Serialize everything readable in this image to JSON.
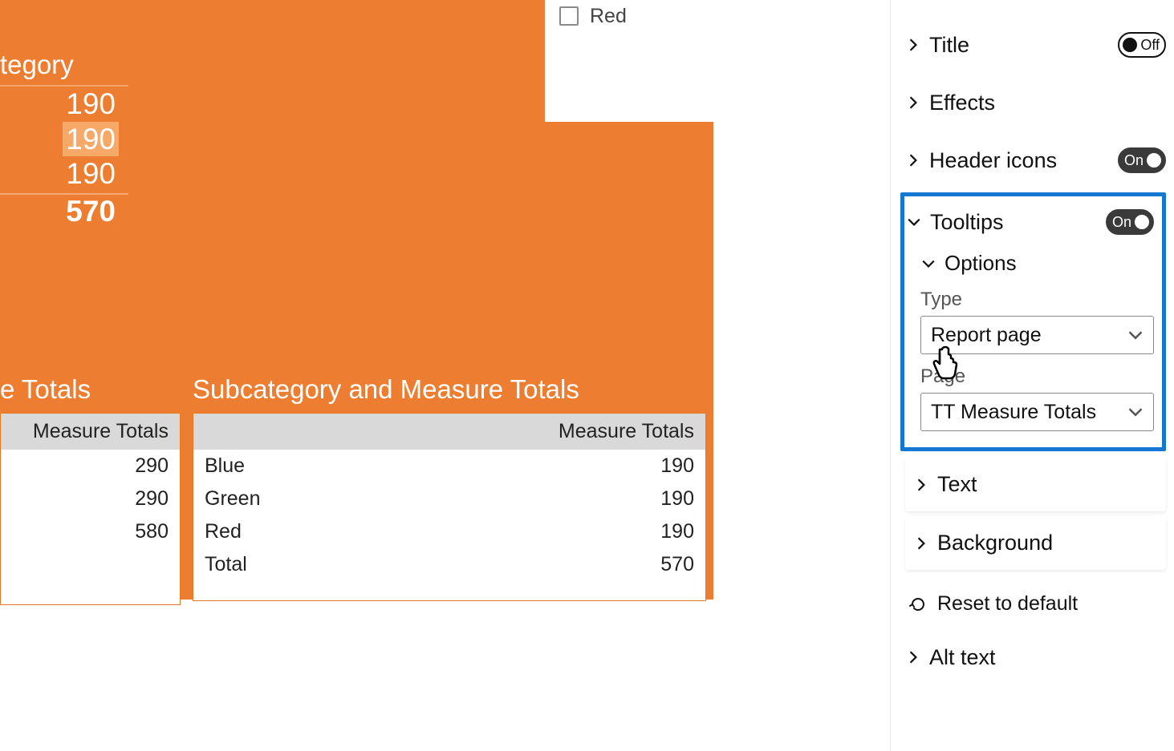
{
  "slicer": {
    "item_label": "Red"
  },
  "topleft": {
    "title": "tegory",
    "rows": [
      "190",
      "190",
      "190"
    ],
    "total": "570"
  },
  "left_table": {
    "title": "e Totals",
    "header": "Measure Totals",
    "rows": [
      {
        "value": "290"
      },
      {
        "value": "290"
      },
      {
        "value": "580"
      }
    ]
  },
  "right_table": {
    "title": "Subcategory and Measure Totals",
    "header": "Measure Totals",
    "rows": [
      {
        "label": "Blue",
        "value": "190"
      },
      {
        "label": "Green",
        "value": "190"
      },
      {
        "label": "Red",
        "value": "190"
      },
      {
        "label": "Total",
        "value": "570"
      }
    ]
  },
  "panel": {
    "title": {
      "label": "Title",
      "state": "Off"
    },
    "effects": {
      "label": "Effects"
    },
    "header_icons": {
      "label": "Header icons",
      "state": "On"
    },
    "tooltips": {
      "label": "Tooltips",
      "state": "On",
      "options_label": "Options",
      "type_label": "Type",
      "type_value": "Report page",
      "page_label": "Page",
      "page_value": "TT Measure Totals"
    },
    "text": {
      "label": "Text"
    },
    "background": {
      "label": "Background"
    },
    "reset": {
      "label": "Reset to default"
    },
    "alt_text": {
      "label": "Alt text"
    }
  }
}
